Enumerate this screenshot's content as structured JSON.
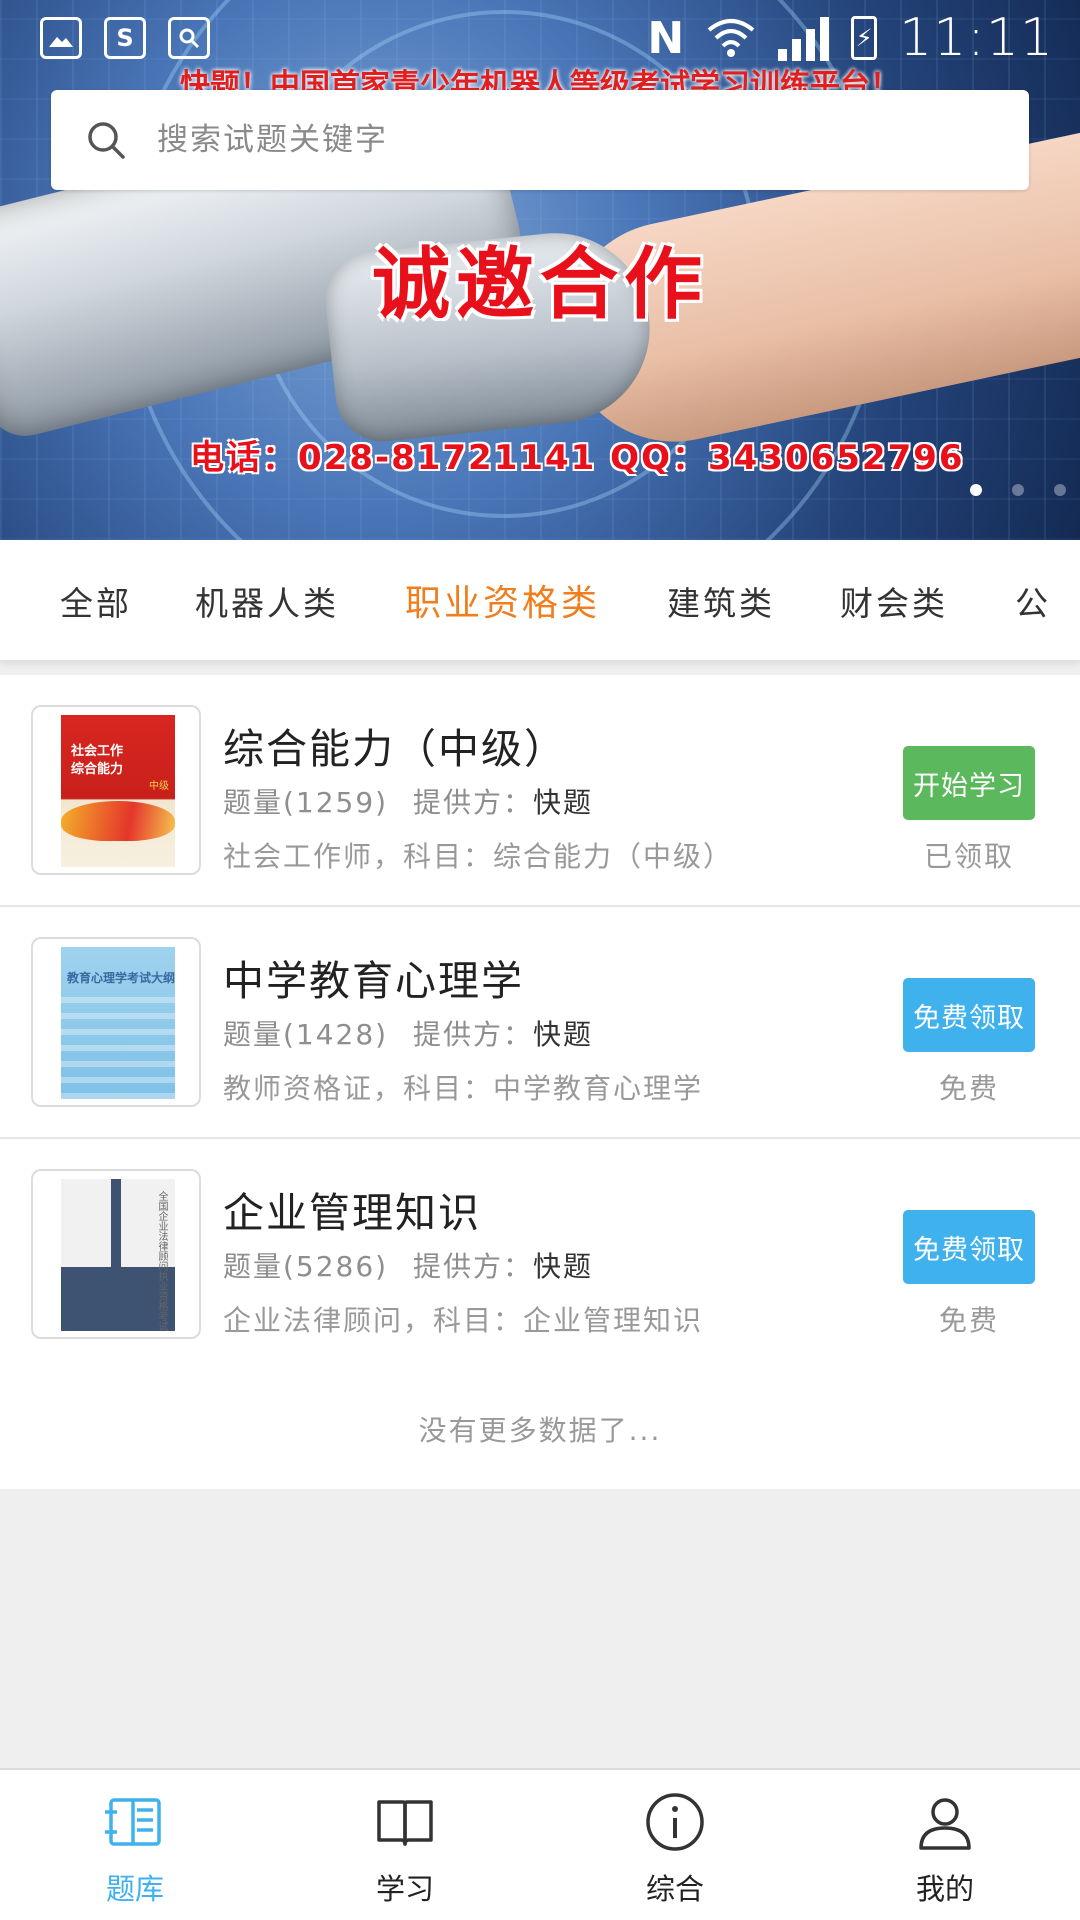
{
  "status_bar": {
    "time": "11:11",
    "network_label": "N"
  },
  "banner": {
    "top_text": "快题！中国首家青少年机器人等级考试学习训练平台！",
    "title": "诚邀合作",
    "contact": "电话：028-81721141 QQ：3430652796",
    "slide_count": 3,
    "active_slide": 1
  },
  "search": {
    "placeholder": "搜索试题关键字",
    "value": ""
  },
  "tabs": [
    {
      "label": "全部",
      "active": false
    },
    {
      "label": "机器人类",
      "active": false
    },
    {
      "label": "职业资格类",
      "active": true
    },
    {
      "label": "建筑类",
      "active": false
    },
    {
      "label": "财会类",
      "active": false
    },
    {
      "label": "公",
      "active": false
    }
  ],
  "items": [
    {
      "title": "综合能力（中级）",
      "count_label": "题量(1259)",
      "provider_label": "提供方：",
      "provider": "快题",
      "subject": "社会工作师，科目：综合能力（中级）",
      "button": "开始学习",
      "button_color": "#5cb85c",
      "status": "已领取",
      "cover_text": "社会工作\n综合能力",
      "cover_tag": "中级"
    },
    {
      "title": "中学教育心理学",
      "count_label": "题量(1428)",
      "provider_label": "提供方：",
      "provider": "快题",
      "subject": "教师资格证，科目：中学教育心理学",
      "button": "免费领取",
      "button_color": "#3fb2ee",
      "status": "免费",
      "cover_text": "教育心理学考试大纲"
    },
    {
      "title": "企业管理知识",
      "count_label": "题量(5286)",
      "provider_label": "提供方：",
      "provider": "快题",
      "subject": "企业法律顾问，科目：企业管理知识",
      "button": "免费领取",
      "button_color": "#3fb2ee",
      "status": "免费",
      "cover_text": "全国企业法律顾问执业资格考试"
    }
  ],
  "list_footer": "没有更多数据了...",
  "bottom_nav": [
    {
      "label": "题库",
      "icon": "question-bank-icon",
      "active": true
    },
    {
      "label": "学习",
      "icon": "book-icon",
      "active": false
    },
    {
      "label": "综合",
      "icon": "info-icon",
      "active": false
    },
    {
      "label": "我的",
      "icon": "profile-icon",
      "active": false
    }
  ],
  "colors": {
    "accent_orange": "#f07e1d",
    "accent_blue": "#3fb2ee",
    "green": "#5cb85c"
  }
}
